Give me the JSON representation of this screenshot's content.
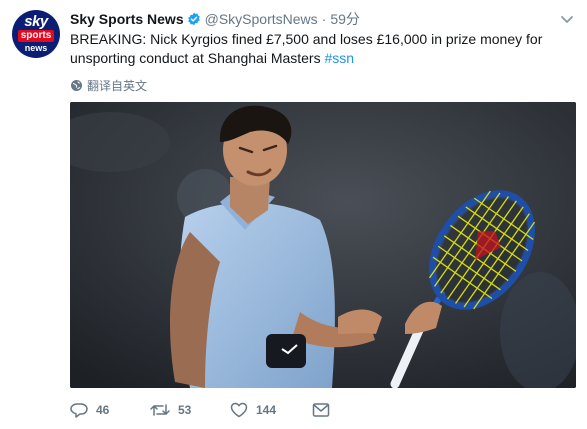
{
  "account": {
    "avatar_text": {
      "line1": "sky",
      "line2": "sports",
      "line3": "news"
    },
    "name": "Sky Sports News",
    "handle": "@SkySportsNews",
    "time": "59分"
  },
  "tweet": {
    "text": "BREAKING: Nick Kyrgios fined £7,500 and loses £16,000 in prize money for unsporting conduct at Shanghai Masters",
    "hashtag": "#ssn",
    "translate_label": "翻译自英文"
  },
  "media": {
    "icon": "photo",
    "description_visible": false
  },
  "actions": {
    "reply": {
      "icon": "reply-icon",
      "count": "46"
    },
    "retweet": {
      "icon": "retweet-icon",
      "count": "53"
    },
    "like": {
      "icon": "heart-icon",
      "count": "144"
    },
    "message": {
      "icon": "envelope-icon"
    }
  },
  "colors": {
    "link": "#1b95e0",
    "verified": "#1da1f2",
    "muted": "#657786",
    "sky_blue": "#0b1e74",
    "sky_red": "#e10a1f",
    "racket_yellow": "#e8f000"
  }
}
